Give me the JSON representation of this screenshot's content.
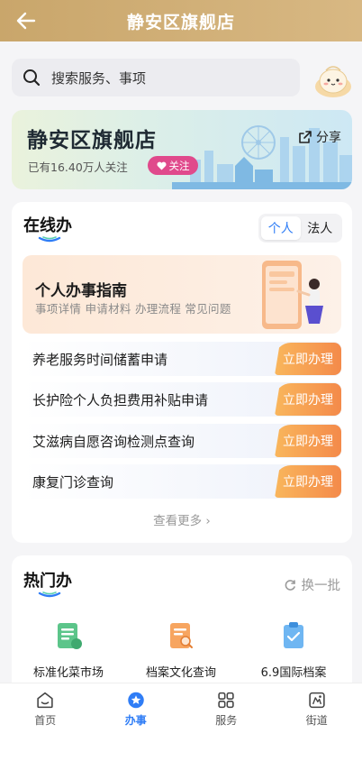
{
  "header": {
    "title": "静安区旗舰店"
  },
  "search": {
    "placeholder": "搜索服务、事项"
  },
  "banner": {
    "title": "静安区旗舰店",
    "followers": "已有16.40万人关注",
    "follow_label": "关注",
    "share_label": "分享"
  },
  "online": {
    "title": "在线办",
    "tabs": [
      {
        "label": "个人",
        "active": true
      },
      {
        "label": "法人",
        "active": false
      }
    ],
    "guide": {
      "title": "个人办事指南",
      "subtitle": "事项详情 申请材料 办理流程 常见问题"
    },
    "services": [
      {
        "name": "养老服务时间储蓄申请",
        "action": "立即办理"
      },
      {
        "name": "长护险个人负担费用补贴申请",
        "action": "立即办理"
      },
      {
        "name": "艾滋病自愿咨询检测点查询",
        "action": "立即办理"
      },
      {
        "name": "康复门诊查询",
        "action": "立即办理"
      }
    ],
    "more_label": "查看更多 ›"
  },
  "hot": {
    "title": "热门办",
    "swap_label": "换一批",
    "items": [
      {
        "label": "标准化菜市场",
        "icon": "document-green-icon"
      },
      {
        "label": "档案文化查询",
        "icon": "file-search-orange-icon"
      },
      {
        "label": "6.9国际档案",
        "icon": "clipboard-blue-icon"
      }
    ]
  },
  "tabbar": {
    "items": [
      {
        "label": "首页",
        "icon": "home-icon",
        "active": false
      },
      {
        "label": "办事",
        "icon": "star-badge-icon",
        "active": true
      },
      {
        "label": "服务",
        "icon": "grid-icon",
        "active": false
      },
      {
        "label": "街道",
        "icon": "street-icon",
        "active": false
      }
    ]
  },
  "colors": {
    "header": "#c9a66b",
    "accent": "#2f7df6",
    "action": "#f48a4a",
    "follow": "#e04a8c"
  }
}
